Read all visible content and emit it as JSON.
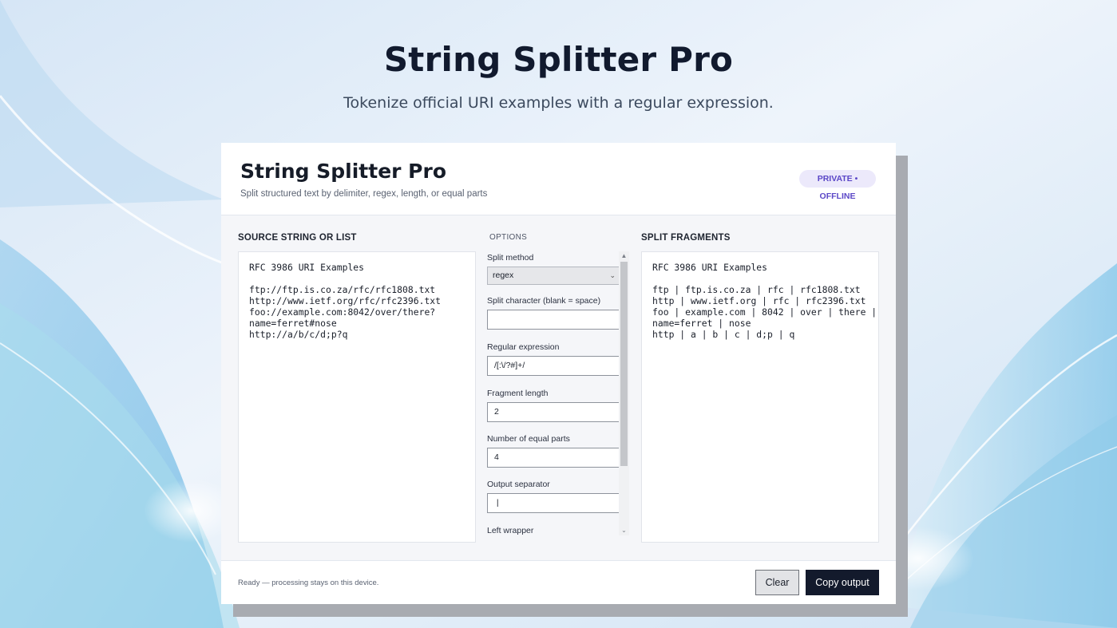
{
  "hero": {
    "title": "String Splitter Pro",
    "subtitle": "Tokenize official URI examples with a regular expression."
  },
  "app": {
    "title": "String Splitter Pro",
    "subtitle": "Split structured text by delimiter, regex, length, or equal parts",
    "badge": "PRIVATE • OFFLINE"
  },
  "source": {
    "label": "SOURCE STRING OR LIST",
    "text": "RFC 3986 URI Examples\n\nftp://ftp.is.co.za/rfc/rfc1808.txt\nhttp://www.ietf.org/rfc/rfc2396.txt\nfoo://example.com:8042/over/there?\nname=ferret#nose\nhttp://a/b/c/d;p?q"
  },
  "options": {
    "label": "OPTIONS",
    "split_method": {
      "label": "Split method",
      "value": "regex"
    },
    "split_character": {
      "label": "Split character (blank = space)",
      "value": ""
    },
    "regex": {
      "label": "Regular expression",
      "value": "/[:\\/?#]+/"
    },
    "fragment_length": {
      "label": "Fragment length",
      "value": "2"
    },
    "equal_parts": {
      "label": "Number of equal parts",
      "value": "4"
    },
    "output_separator": {
      "label": "Output separator",
      "value": " | "
    },
    "left_wrapper": {
      "label": "Left wrapper"
    }
  },
  "output": {
    "label": "SPLIT FRAGMENTS",
    "text": "RFC 3986 URI Examples\n\nftp | ftp.is.co.za | rfc | rfc1808.txt\nhttp | www.ietf.org | rfc | rfc2396.txt\nfoo | example.com | 8042 | over | there |\nname=ferret | nose\nhttp | a | b | c | d;p | q"
  },
  "footer": {
    "status": "Ready — processing stays on this device.",
    "clear_label": "Clear",
    "copy_label": "Copy output"
  },
  "colors": {
    "accent_dark": "#131a2c",
    "badge_bg": "#ece9fb",
    "badge_text": "#5b47c7"
  }
}
